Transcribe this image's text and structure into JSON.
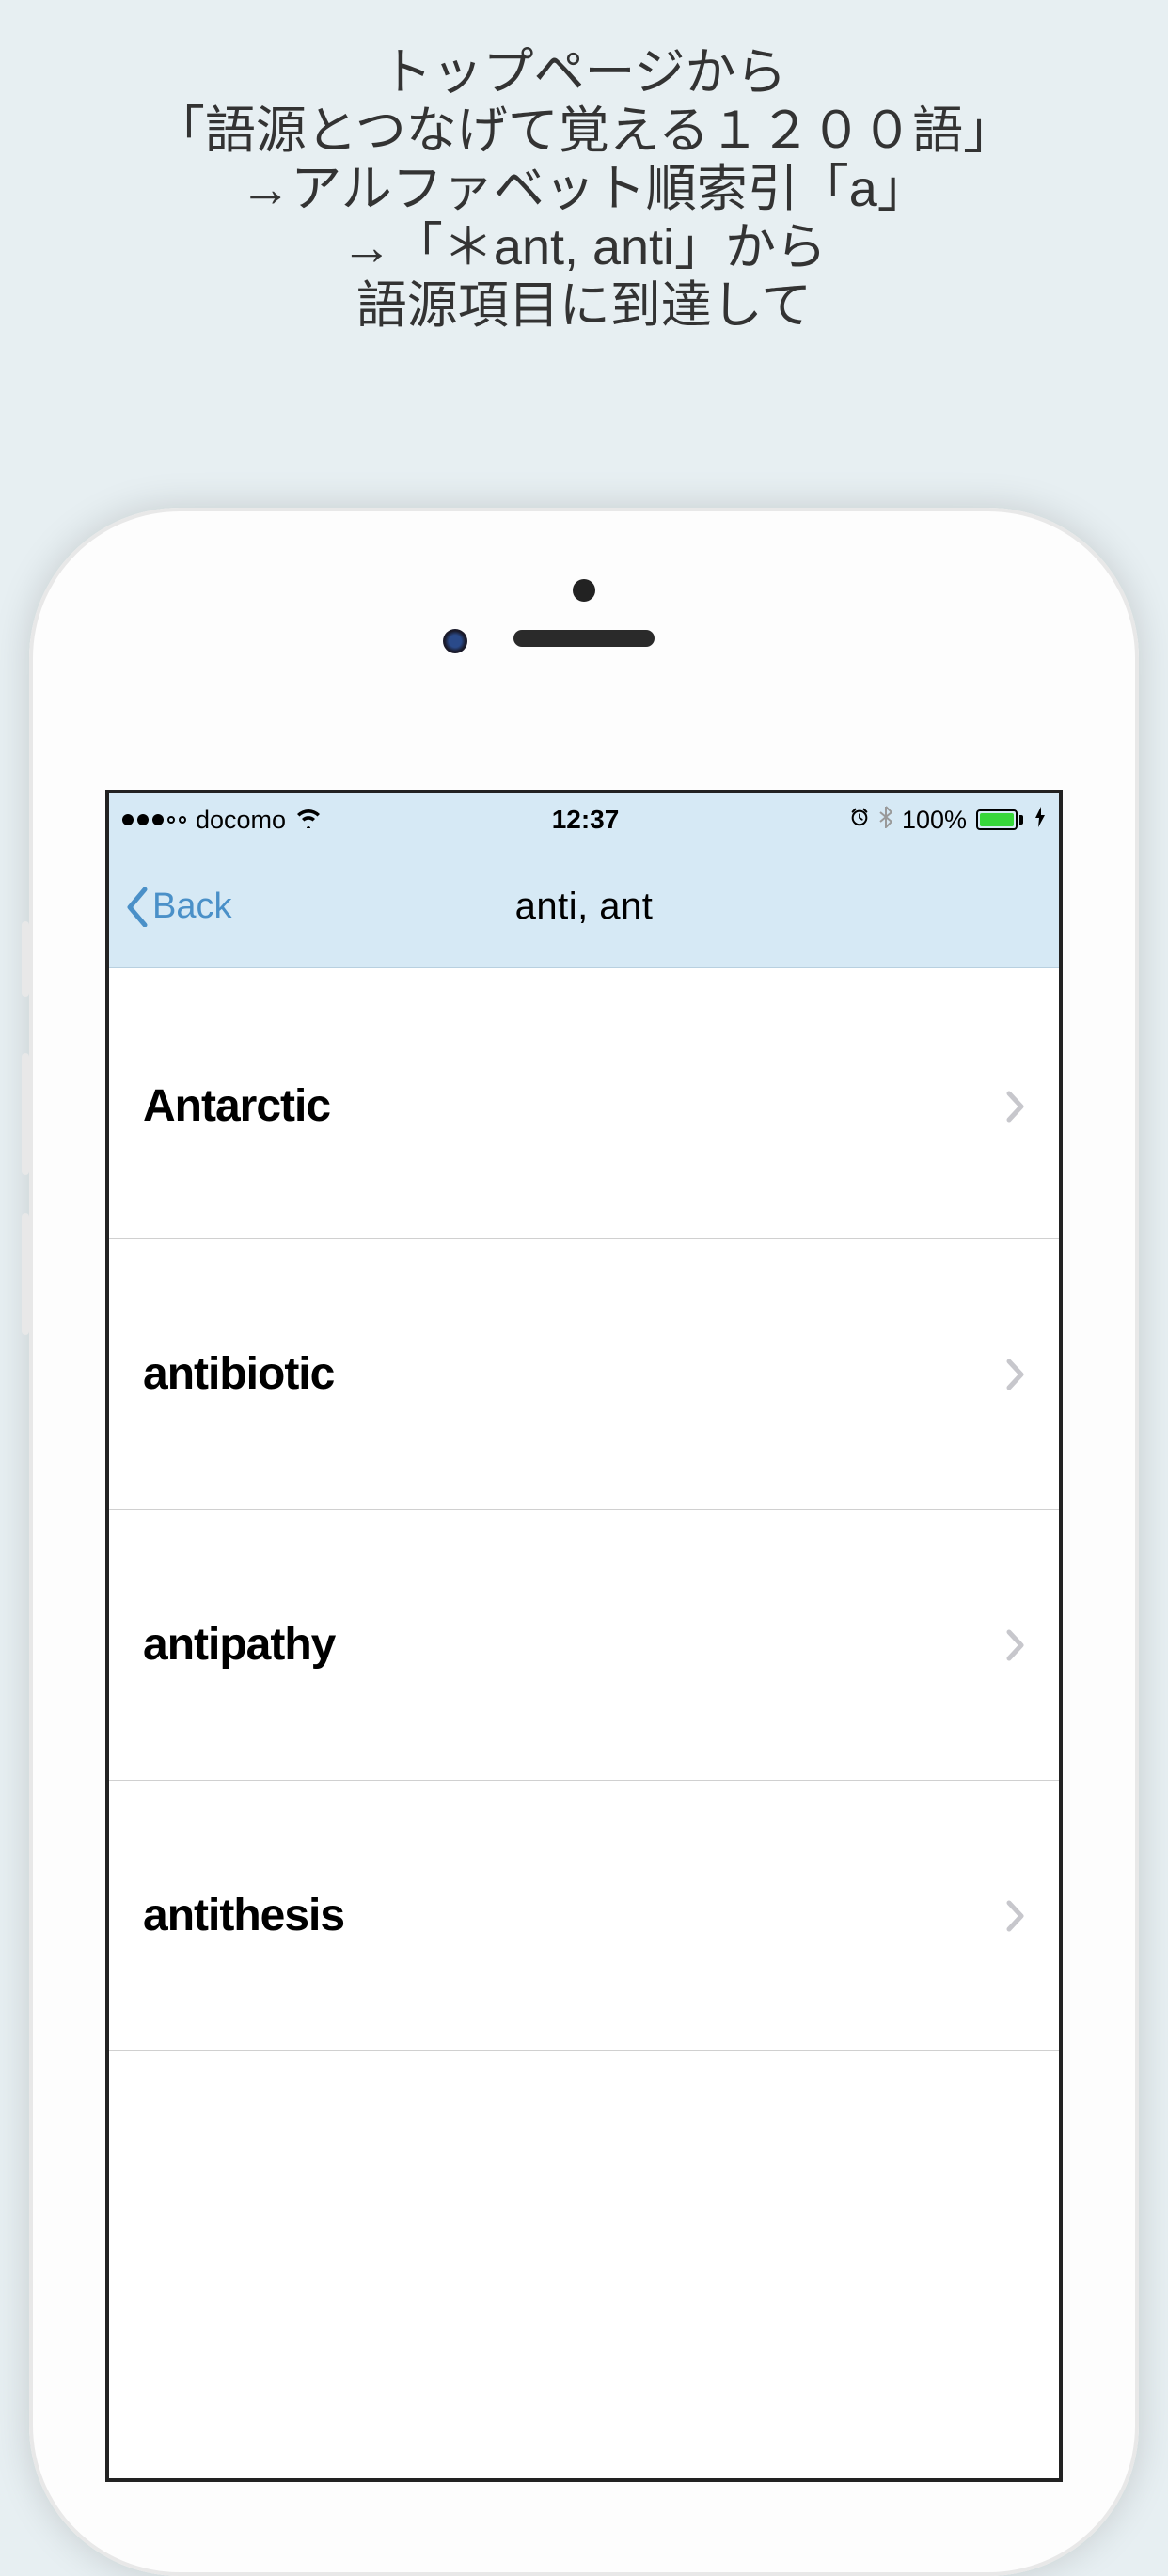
{
  "description": {
    "line1": "トップページから",
    "line2": "「語源とつなげて覚える１２００語」",
    "line3": "→アルファベット順索引「a」",
    "line4": "→「＊ant, anti」から",
    "line5": "語源項目に到達して"
  },
  "statusBar": {
    "carrier": "docomo",
    "time": "12:37",
    "batteryPct": "100%"
  },
  "nav": {
    "backLabel": "Back",
    "title": "anti, ant"
  },
  "list": [
    {
      "word": "Antarctic"
    },
    {
      "word": "antibiotic"
    },
    {
      "word": "antipathy"
    },
    {
      "word": "antithesis"
    }
  ]
}
